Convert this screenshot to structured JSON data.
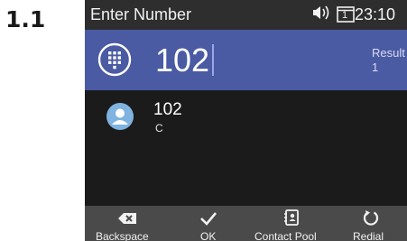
{
  "step_label": "1.1",
  "statusbar": {
    "title": "Enter Number",
    "icons": [
      "speaker-volume-icon",
      "line-indicator-icon"
    ],
    "line_number": "1",
    "time": "23:10"
  },
  "entry": {
    "icon": "dialpad-icon",
    "number": "102",
    "result_label": "Result",
    "result_count": "1"
  },
  "contacts": [
    {
      "icon": "person-avatar-icon",
      "number": "102",
      "sub": "C"
    }
  ],
  "softkeys": [
    {
      "label": "Backspace",
      "icon": "backspace-icon"
    },
    {
      "label": "OK",
      "icon": "checkmark-icon"
    },
    {
      "label": "Contact Pool",
      "icon": "contact-book-icon"
    },
    {
      "label": "Redial",
      "icon": "redial-icon"
    }
  ],
  "colors": {
    "accent": "#4a5aa3",
    "screen_bg": "#1b1b1b",
    "statusbar_bg": "#2e2e2e",
    "softkey_bg": "#4a4a4a",
    "avatar": "#7fb3e0"
  }
}
